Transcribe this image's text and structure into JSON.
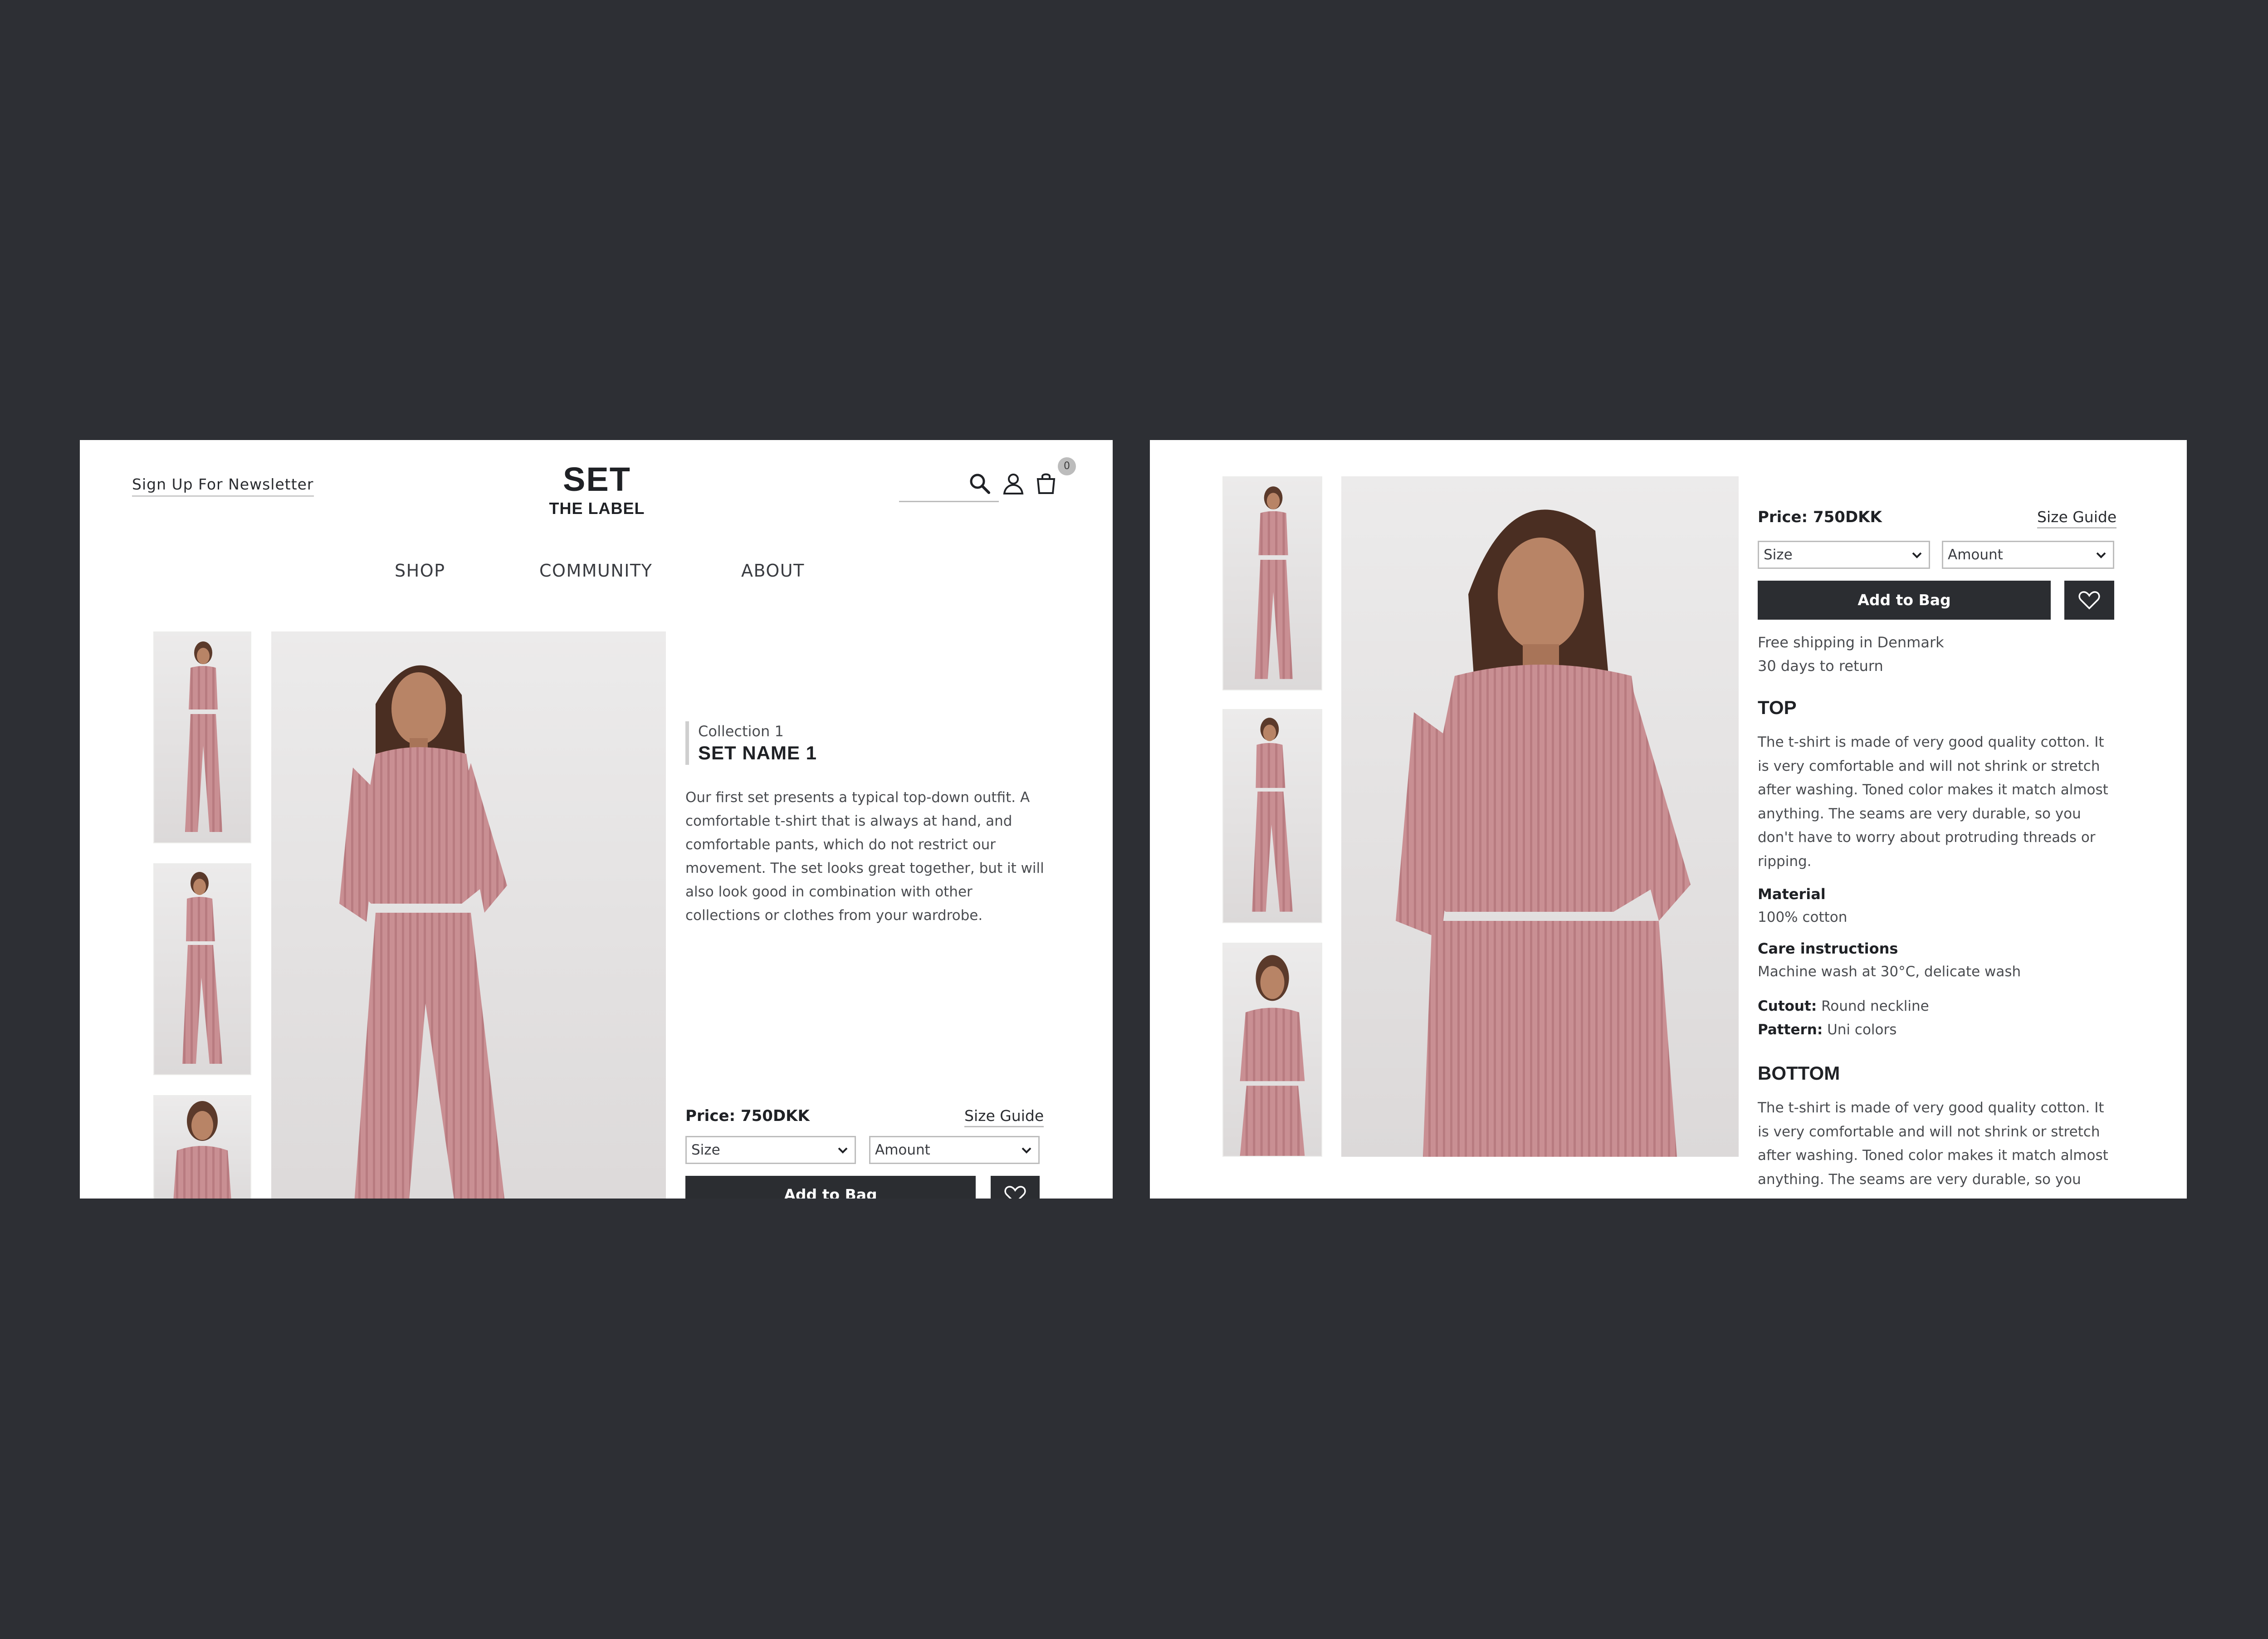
{
  "header": {
    "newsletter": "Sign Up For Newsletter",
    "logo_title": "SET",
    "logo_subtitle": "THE LABEL",
    "cart_count": "0",
    "icons": [
      "search-icon",
      "user-icon",
      "bag-icon"
    ]
  },
  "nav": {
    "items": [
      "SHOP",
      "COMMUNITY",
      "ABOUT"
    ]
  },
  "product": {
    "collection": "Collection 1",
    "name": "SET NAME 1",
    "description_lines": [
      "Our first set presents a typical top-down outfit. A",
      "comfortable t-shirt that is always at hand, and",
      "comfortable pants, which do not restrict our",
      "movement. The set looks great together, but it will",
      "also look good in combination with other",
      "collections or clothes from your wardrobe."
    ],
    "price": "Price: 750DKK",
    "size_guide": "Size Guide",
    "size_select": "Size",
    "amount_select": "Amount",
    "add_to_bag": "Add to Bag",
    "shipping": "Free shipping in Denmark",
    "returns": "30 days to return",
    "top_heading": "TOP",
    "top_lines": [
      "The t-shirt is made of very good quality cotton. It",
      "is very comfortable and will not shrink or stretch",
      "after washing. Toned color makes it match almost",
      "anything. The seams are very durable, so you",
      "don't have to worry about protruding threads or",
      "ripping."
    ],
    "material_label": "Material",
    "material_value": "100% cotton",
    "care_label": "Care instructions",
    "care_value": "Machine wash at 30°C, delicate wash",
    "cutout_label": "Cutout:",
    "cutout_value": "Round neckline",
    "pattern_label": "Pattern:",
    "pattern_value": "Uni colors",
    "bottom_heading": "BOTTOM",
    "bottom_lines": [
      "The t-shirt is made of very good quality cotton. It",
      "is very comfortable and will not shrink or stretch",
      "after washing. Toned color makes it match almost",
      "anything. The seams are very durable, so you"
    ]
  },
  "colors": {
    "background": "#2d2f34",
    "panel": "#ffffff",
    "button": "#2b2d31",
    "garment": "#c98f93",
    "photo_bg": "#e8e6e6"
  }
}
